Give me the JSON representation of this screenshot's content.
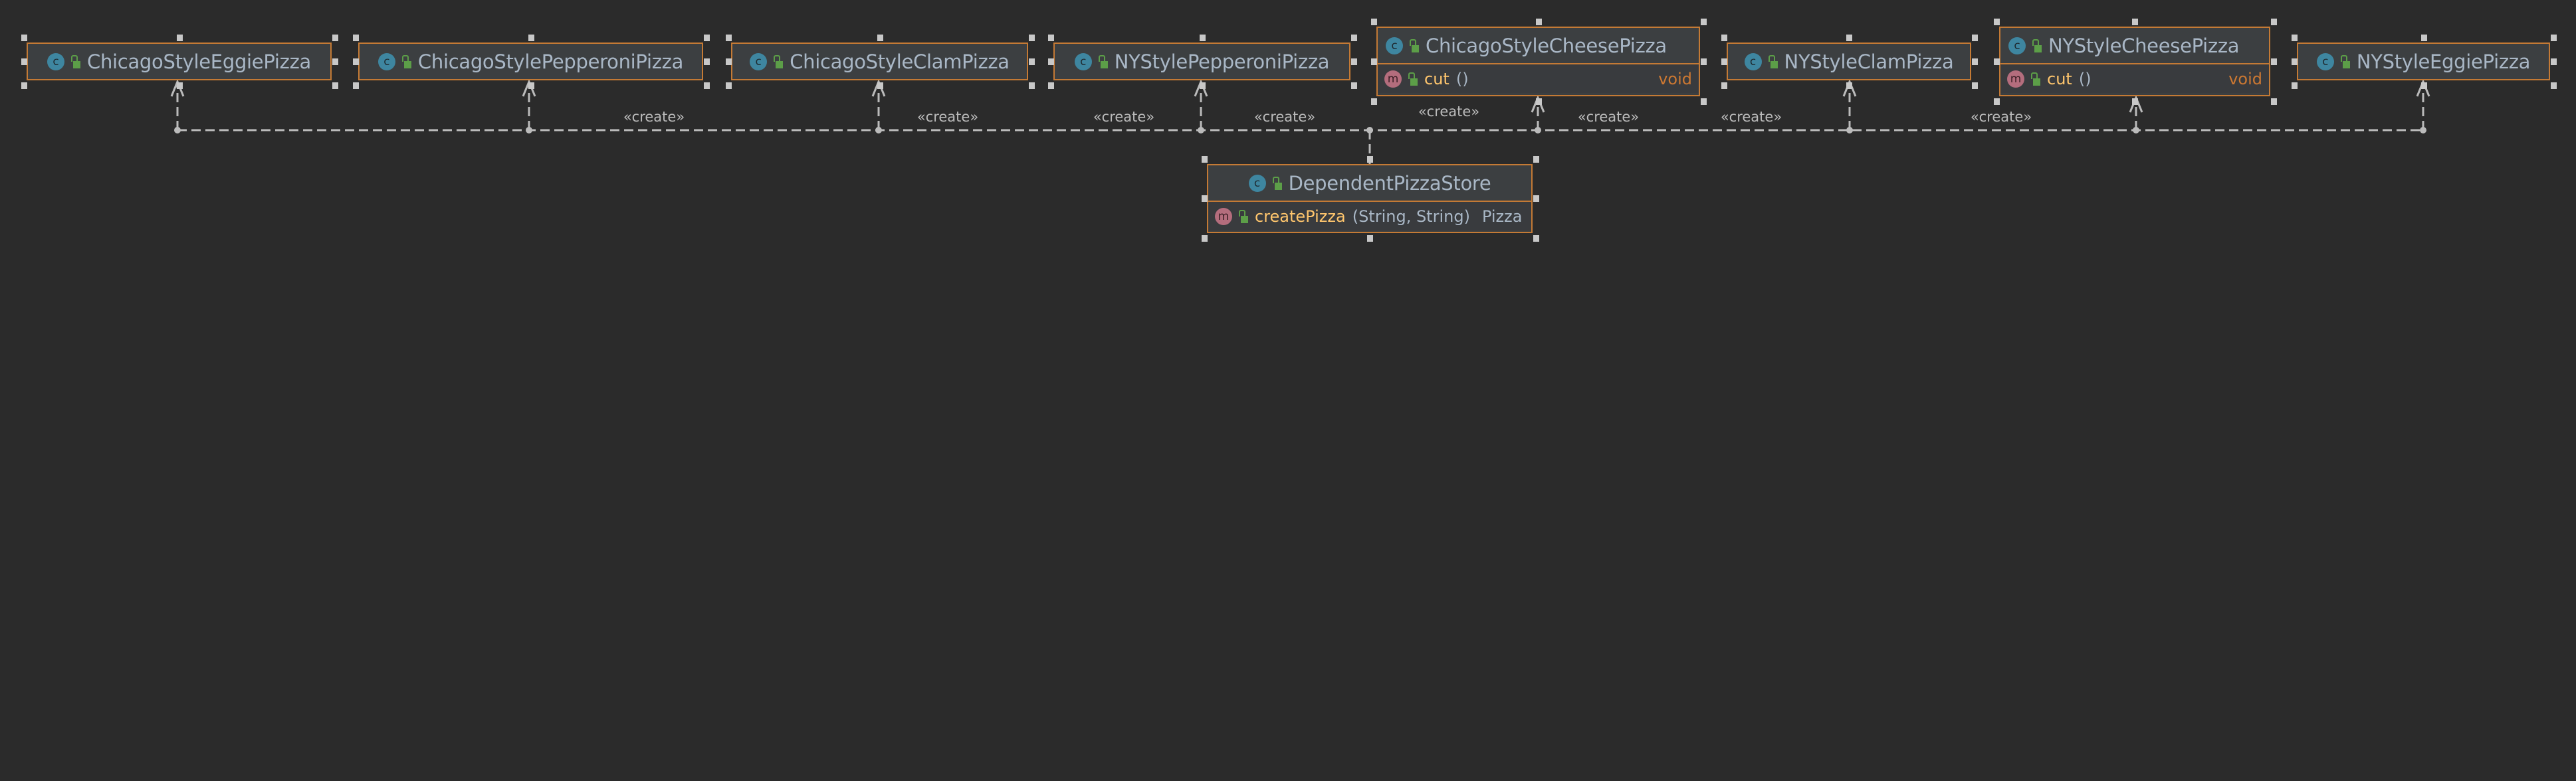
{
  "classes": [
    {
      "name": "ChicagoStyleEggiePizza",
      "icon": "class-icon",
      "methods": []
    },
    {
      "name": "ChicagoStylePepperoniPizza",
      "icon": "class-icon",
      "methods": []
    },
    {
      "name": "ChicagoStyleClamPizza",
      "icon": "class-icon",
      "methods": []
    },
    {
      "name": "NYStylePepperoniPizza",
      "icon": "class-icon",
      "methods": []
    },
    {
      "name": "ChicagoStyleCheesePizza",
      "icon": "class-icon",
      "methods": [
        {
          "name": "cut",
          "params": "()",
          "returns": "void"
        }
      ]
    },
    {
      "name": "NYStyleClamPizza",
      "icon": "class-icon",
      "methods": []
    },
    {
      "name": "NYStyleCheesePizza",
      "icon": "class-icon",
      "methods": [
        {
          "name": "cut",
          "params": "()",
          "returns": "void"
        }
      ]
    },
    {
      "name": "NYStyleEggiePizza",
      "icon": "class-icon",
      "methods": []
    },
    {
      "name": "DependentPizzaStore",
      "icon": "class-icon",
      "methods": [
        {
          "name": "createPizza",
          "params": "(String, String)",
          "returns": "Pizza"
        }
      ]
    }
  ],
  "relations": {
    "source": "DependentPizzaStore",
    "label": "«create»",
    "targets": [
      "ChicagoStyleEggiePizza",
      "ChicagoStylePepperoniPizza",
      "ChicagoStyleClamPizza",
      "NYStylePepperoniPizza",
      "ChicagoStyleCheesePizza",
      "NYStyleClamPizza",
      "NYStyleCheesePizza",
      "NYStyleEggiePizza"
    ],
    "labels": [
      "«create»",
      "«create»",
      "«create»",
      "«create»",
      "«create»",
      "«create»",
      "«create»",
      "«create»"
    ]
  },
  "colors": {
    "background": "#2b2b2b",
    "border": "#c47a35",
    "text": "#a9b7c6",
    "method": "#ffc66d",
    "keyword": "#cc7832",
    "edge": "#bbbbbb"
  }
}
